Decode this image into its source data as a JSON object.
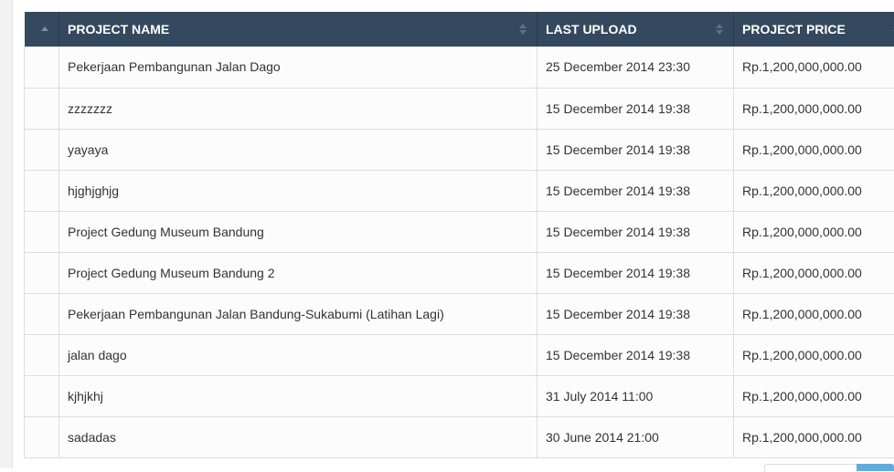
{
  "table": {
    "columns": [
      {
        "label": "PROJECT NAME"
      },
      {
        "label": "LAST UPLOAD"
      },
      {
        "label": "PROJECT PRICE"
      }
    ],
    "rows": [
      {
        "name": "Pekerjaan Pembangunan Jalan Dago",
        "last_upload": "25 December 2014 23:30",
        "price": "Rp.1,200,000,000.00"
      },
      {
        "name": "zzzzzzz",
        "last_upload": "15 December 2014 19:38",
        "price": "Rp.1,200,000,000.00"
      },
      {
        "name": "yayaya",
        "last_upload": "15 December 2014 19:38",
        "price": "Rp.1,200,000,000.00"
      },
      {
        "name": "hjghjghjg",
        "last_upload": "15 December 2014 19:38",
        "price": "Rp.1,200,000,000.00"
      },
      {
        "name": "Project Gedung Museum Bandung",
        "last_upload": "15 December 2014 19:38",
        "price": "Rp.1,200,000,000.00"
      },
      {
        "name": "Project Gedung Museum Bandung 2",
        "last_upload": "15 December 2014 19:38",
        "price": "Rp.1,200,000,000.00"
      },
      {
        "name": "Pekerjaan Pembangunan Jalan Bandung-Sukabumi (Latihan Lagi)",
        "last_upload": "15 December 2014 19:38",
        "price": "Rp.1,200,000,000.00"
      },
      {
        "name": "jalan dago",
        "last_upload": "15 December 2014 19:38",
        "price": "Rp.1,200,000,000.00"
      },
      {
        "name": "kjhjkhj",
        "last_upload": "31 July 2014 11:00",
        "price": "Rp.1,200,000,000.00"
      },
      {
        "name": "sadadas",
        "last_upload": "30 June 2014 21:00",
        "price": "Rp.1,200,000,000.00"
      }
    ]
  },
  "colors": {
    "header_bg": "#34495e",
    "header_text": "#ffffff",
    "row_bg": "#fcfcfc",
    "border": "#dddddd",
    "pager_active": "#5dade2"
  }
}
